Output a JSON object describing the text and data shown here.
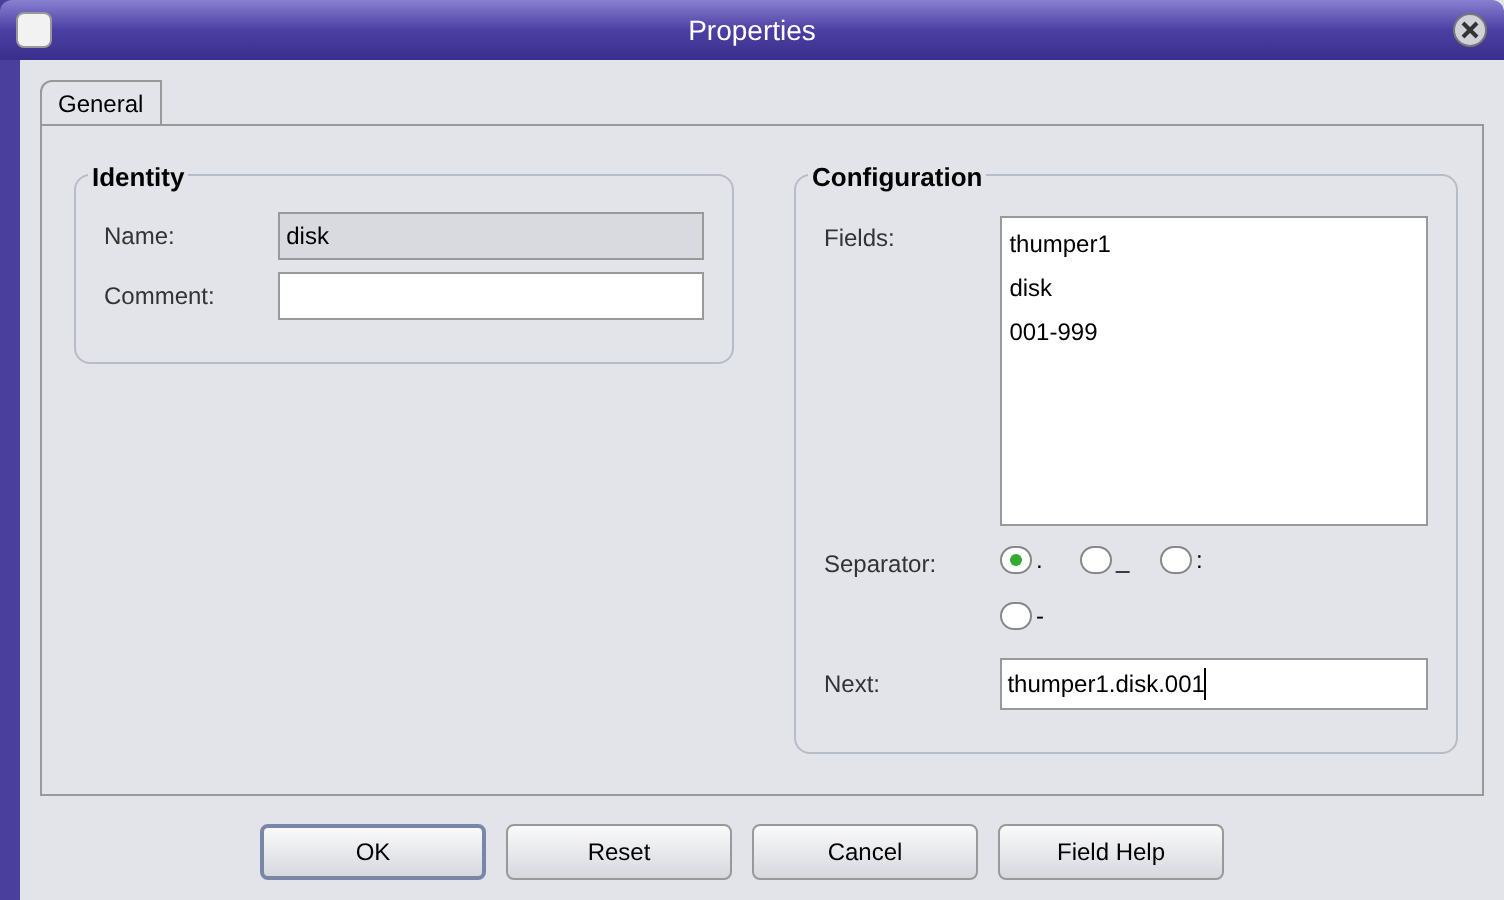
{
  "window": {
    "title": "Properties"
  },
  "tabs": [
    {
      "label": "General",
      "selected": true
    }
  ],
  "identity": {
    "title": "Identity",
    "name_label": "Name:",
    "name_value": "disk",
    "comment_label": "Comment:"
  },
  "configuration": {
    "title": "Configuration",
    "fields_label": "Fields:",
    "fields": [
      "thumper1",
      "disk",
      "001-999"
    ],
    "separator_label": "Separator:",
    "separators": [
      {
        "label": ".",
        "selected": true
      },
      {
        "label": "_",
        "selected": false
      },
      {
        "label": ":",
        "selected": false
      },
      {
        "label": "-",
        "selected": false
      }
    ],
    "next_label": "Next:",
    "next_value": "thumper1.disk.001"
  },
  "buttons": [
    {
      "label": "OK",
      "default": true
    },
    {
      "label": "Reset",
      "default": false
    },
    {
      "label": "Cancel",
      "default": false
    },
    {
      "label": "Field Help",
      "default": false
    }
  ]
}
